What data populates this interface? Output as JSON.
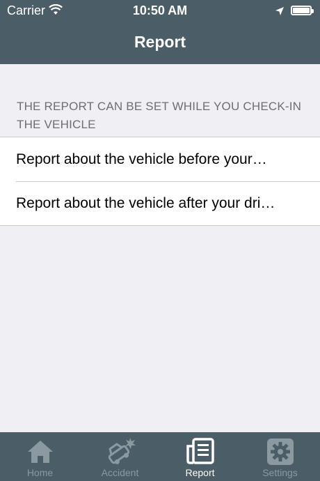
{
  "status_bar": {
    "carrier": "Carrier",
    "time": "10:50 AM"
  },
  "nav": {
    "title": "Report"
  },
  "section": {
    "header": "THE REPORT CAN BE SET WHILE YOU CHECK-IN THE VEHICLE"
  },
  "items": [
    {
      "label": "Report about the vehicle before your…"
    },
    {
      "label": "Report about the vehicle after your dri…"
    }
  ],
  "tabs": [
    {
      "label": "Home",
      "icon": "home-icon",
      "active": false
    },
    {
      "label": "Accident",
      "icon": "accident-car-icon",
      "active": false
    },
    {
      "label": "Report",
      "icon": "report-document-icon",
      "active": true
    },
    {
      "label": "Settings",
      "icon": "gear-icon",
      "active": false
    }
  ],
  "colors": {
    "bar_background": "#4b5d66",
    "tab_inactive": "#8b9aa1",
    "tab_active": "#ffffff",
    "page_background": "#efeff4"
  }
}
